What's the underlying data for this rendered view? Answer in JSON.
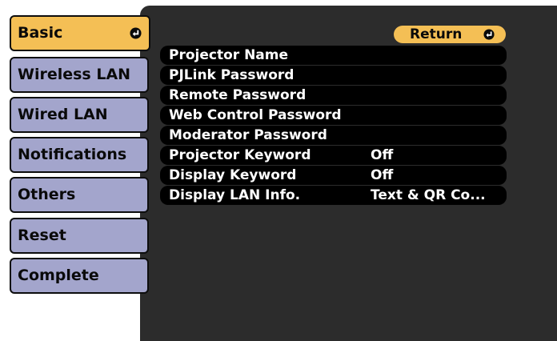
{
  "sidebar": {
    "items": [
      {
        "label": "Basic"
      },
      {
        "label": "Wireless LAN"
      },
      {
        "label": "Wired LAN"
      },
      {
        "label": "Notifications"
      },
      {
        "label": "Others"
      },
      {
        "label": "Reset"
      },
      {
        "label": "Complete"
      }
    ],
    "active_index": 0
  },
  "return_button": {
    "label": "Return"
  },
  "menu": {
    "items": [
      {
        "label": "Projector Name",
        "value": ""
      },
      {
        "label": "PJLink Password",
        "value": ""
      },
      {
        "label": "Remote Password",
        "value": ""
      },
      {
        "label": "Web Control Password",
        "value": ""
      },
      {
        "label": "Moderator Password",
        "value": ""
      },
      {
        "label": "Projector Keyword",
        "value": "Off"
      },
      {
        "label": "Display Keyword",
        "value": "Off"
      },
      {
        "label": "Display LAN Info.",
        "value": "Text & QR Co..."
      }
    ]
  },
  "colors": {
    "accent": "#f4bf55",
    "tab": "#a3a5cc",
    "panel": "#2c2c2c",
    "row": "#000000"
  },
  "icons": {
    "enter": "enter-arrow-icon"
  }
}
